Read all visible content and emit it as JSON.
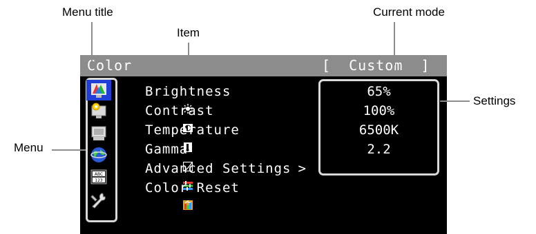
{
  "callouts": {
    "menu_title": "Menu title",
    "item": "Item",
    "current_mode": "Current mode",
    "settings": "Settings",
    "menu": "Menu"
  },
  "osd": {
    "title": "Color",
    "mode": "[  Custom  ]"
  },
  "menu": [
    {
      "icon": "color-palette-icon",
      "selected": true
    },
    {
      "icon": "monitor-screen-icon",
      "selected": false
    },
    {
      "icon": "power-monitor-icon",
      "selected": false
    },
    {
      "icon": "globe-icon",
      "selected": false
    },
    {
      "icon": "abc-123-icon",
      "selected": false
    },
    {
      "icon": "wrench-tools-icon",
      "selected": false
    }
  ],
  "items": [
    {
      "label": "Brightness",
      "icon": "brightness-icon",
      "value": "65%"
    },
    {
      "label": "Contrast",
      "icon": "contrast-icon",
      "value": "100%"
    },
    {
      "label": "Temperature",
      "icon": "temperature-icon",
      "value": "6500K"
    },
    {
      "label": "Gamma",
      "icon": "gamma-icon",
      "value": "2.2"
    },
    {
      "label": "Advanced Settings",
      "icon": "advanced-settings-icon",
      "arrow": ">"
    },
    {
      "label": "Color Reset",
      "icon": "color-reset-icon"
    }
  ],
  "colors": {
    "osd_background": "#000000",
    "titlebar": "#8c8c8c",
    "selected_menu": "#1f3fd6",
    "frame": "#d9d9d9"
  }
}
